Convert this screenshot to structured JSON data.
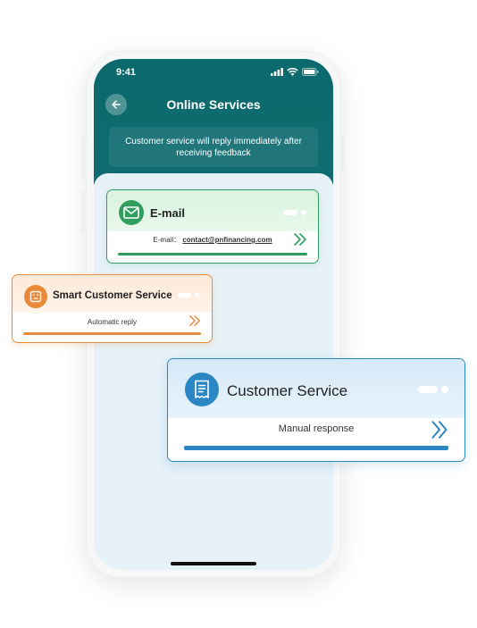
{
  "status": {
    "time": "9:41"
  },
  "header": {
    "title": "Online Services",
    "notice": "Customer service will reply immediately after receiving feedback"
  },
  "cards": {
    "email": {
      "title": "E-mail",
      "label": "E-mail：",
      "address": "contact@pnfinancing.com",
      "color": "#2f9e5e",
      "icon": "envelope-icon"
    },
    "smart": {
      "title": "Smart Customer Service",
      "subtitle": "Automatic reply",
      "color": "#e98a3a",
      "icon": "robot-icon"
    },
    "customer_service": {
      "title": "Customer Service",
      "subtitle": "Manual response",
      "color": "#2b87c4",
      "icon": "receipt-icon"
    }
  },
  "colors": {
    "header_bg": "#0b6a6d",
    "screen_bg": "#e6f1f8"
  }
}
